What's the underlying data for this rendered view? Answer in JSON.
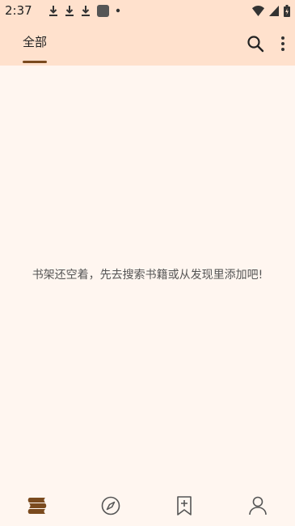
{
  "status_bar": {
    "time": "2:37",
    "left_icons": [
      "download-icon",
      "download-icon",
      "download-icon",
      "app-icon",
      "dot-icon"
    ],
    "right_icons": [
      "wifi-icon",
      "signal-icon",
      "battery-icon"
    ]
  },
  "top_bar": {
    "tab_label": "全部",
    "actions": [
      "search-icon",
      "more-vert-icon"
    ]
  },
  "content": {
    "empty_message": "书架还空着，先去搜索书籍或从发现里添加吧!"
  },
  "bottom_nav": {
    "items": [
      "bookshelf-icon",
      "compass-icon",
      "bookmark-add-icon",
      "person-icon"
    ],
    "active_index": 0
  },
  "colors": {
    "header_bg": "#ffe1cd",
    "page_bg": "#fff6f0",
    "accent": "#7a4a1e",
    "icon": "#555555"
  }
}
